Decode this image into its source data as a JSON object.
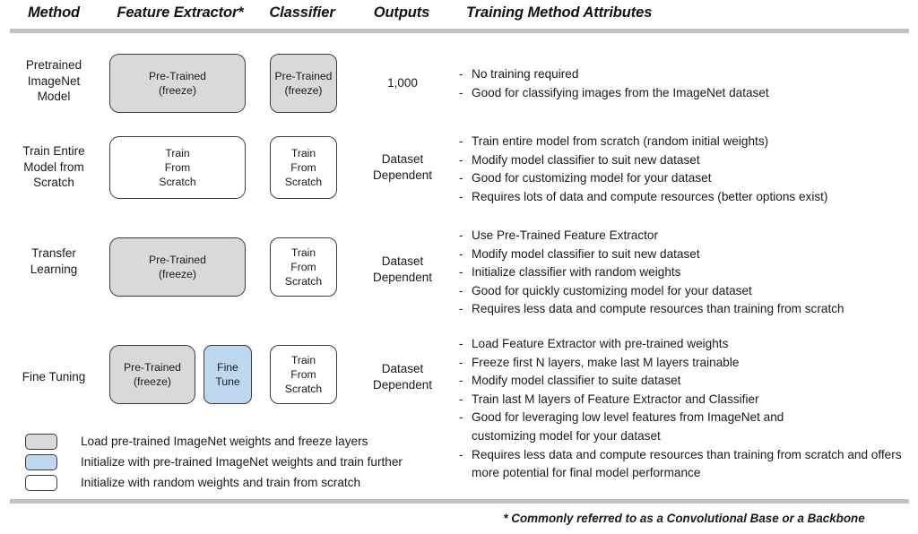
{
  "figure": {
    "title": "Training Method Attributes comparison table",
    "accent_gray": "#c2c2c2",
    "box_gray": "#d9d9d9",
    "box_blue": "#bdd7ee",
    "box_white": "#ffffff",
    "box_border": "#3b3b3b"
  },
  "headers": {
    "method": "Method",
    "feature_extractor": "Feature Extractor*",
    "classifier": "Classifier",
    "outputs": "Outputs",
    "attributes": "Training Method Attributes"
  },
  "rows": [
    {
      "method": "Pretrained\nImageNet\nModel",
      "method_lines": [
        "Pretrained",
        "ImageNet",
        "Model"
      ],
      "feature_extractor": {
        "label_lines": [
          "Pre-Trained",
          "(freeze)"
        ],
        "fill": "gray"
      },
      "feature_extractor_extra": null,
      "classifier": {
        "label_lines": [
          "Pre-Trained",
          "(freeze)"
        ],
        "fill": "gray"
      },
      "outputs_lines": [
        "1,000"
      ],
      "attributes": [
        "No training required",
        "Good for classifying images from the ImageNet dataset"
      ]
    },
    {
      "method": "Train Entire\nModel from\nScratch",
      "method_lines": [
        "Train Entire",
        "Model from",
        "Scratch"
      ],
      "feature_extractor": {
        "label_lines": [
          "Train",
          "From",
          "Scratch"
        ],
        "fill": "white"
      },
      "feature_extractor_extra": null,
      "classifier": {
        "label_lines": [
          "Train",
          "From",
          "Scratch"
        ],
        "fill": "white"
      },
      "outputs_lines": [
        "Dataset",
        "Dependent"
      ],
      "attributes": [
        "Train entire model from scratch (random initial weights)",
        "Modify model classifier to suit new dataset",
        "Good for customizing model for your dataset",
        "Requires lots of data and compute resources (better options exist)"
      ]
    },
    {
      "method": "Transfer\nLearning",
      "method_lines": [
        "Transfer",
        "Learning"
      ],
      "feature_extractor": {
        "label_lines": [
          "Pre-Trained",
          "(freeze)"
        ],
        "fill": "gray"
      },
      "feature_extractor_extra": null,
      "classifier": {
        "label_lines": [
          "Train",
          "From",
          "Scratch"
        ],
        "fill": "white"
      },
      "outputs_lines": [
        "Dataset",
        "Dependent"
      ],
      "attributes": [
        "Use Pre-Trained Feature Extractor",
        "Modify model classifier to suit new dataset",
        "Initialize classifier with random weights",
        "Good for quickly customizing model for your dataset",
        "Requires less data and compute resources than training from scratch"
      ]
    },
    {
      "method": "Fine Tuning",
      "method_lines": [
        "Fine Tuning"
      ],
      "feature_extractor": {
        "label_lines": [
          "Pre-Trained",
          "(freeze)"
        ],
        "fill": "gray"
      },
      "feature_extractor_extra": {
        "label_lines": [
          "Fine",
          "Tune"
        ],
        "fill": "blue"
      },
      "classifier": {
        "label_lines": [
          "Train",
          "From",
          "Scratch"
        ],
        "fill": "white"
      },
      "outputs_lines": [
        "Dataset",
        "Dependent"
      ],
      "attributes": [
        "Load Feature Extractor with pre-trained weights",
        "Freeze first N layers, make last M layers trainable",
        "Modify model classifier to suite dataset",
        "Train last M layers of Feature Extractor and Classifier",
        "Good for leveraging low level features from ImageNet and customizing model for your dataset",
        "Requires less data and compute resources than training from scratch and offers more potential for final model performance"
      ]
    }
  ],
  "legend": [
    {
      "fill": "gray",
      "text": "Load pre-trained ImageNet weights and freeze layers"
    },
    {
      "fill": "blue",
      "text": "Initialize with pre-trained ImageNet weights and train further"
    },
    {
      "fill": "white",
      "text": "Initialize with random weights and train from scratch"
    }
  ],
  "footnote": "* Commonly referred to as a Convolutional Base or a Backbone"
}
